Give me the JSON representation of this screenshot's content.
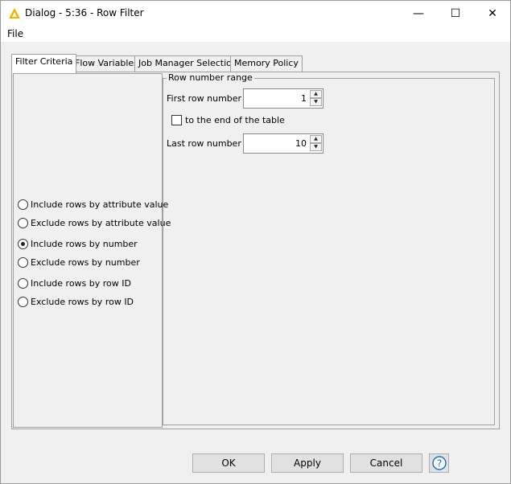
{
  "window": {
    "title": "Dialog - 5:36 - Row Filter",
    "controls": {
      "minimize": "—",
      "maximize": "☐",
      "close": "✕"
    }
  },
  "menu": {
    "file": "File"
  },
  "tabs": [
    {
      "label": "Filter Criteria",
      "active": true
    },
    {
      "label": "Flow Variables",
      "active": false
    },
    {
      "label": "Job Manager Selection",
      "active": false
    },
    {
      "label": "Memory Policy",
      "active": false
    }
  ],
  "filter_options": [
    {
      "label": "Include rows by attribute value",
      "selected": false
    },
    {
      "label": "Exclude rows by attribute value",
      "selected": false
    },
    {
      "label": "Include rows by number",
      "selected": true
    },
    {
      "label": "Exclude rows by number",
      "selected": false
    },
    {
      "label": "Include rows by row ID",
      "selected": false
    },
    {
      "label": "Exclude rows by row ID",
      "selected": false
    }
  ],
  "row_range": {
    "group_title": "Row number range",
    "first_label": "First row number",
    "first_value": "1",
    "to_end_label": "to the end of the table",
    "to_end_checked": false,
    "last_label": "Last row number",
    "last_value": "10"
  },
  "buttons": {
    "ok": "OK",
    "apply": "Apply",
    "cancel": "Cancel"
  },
  "colors": {
    "accent": "#1a73c8",
    "warning_icon": "#f2b600"
  }
}
